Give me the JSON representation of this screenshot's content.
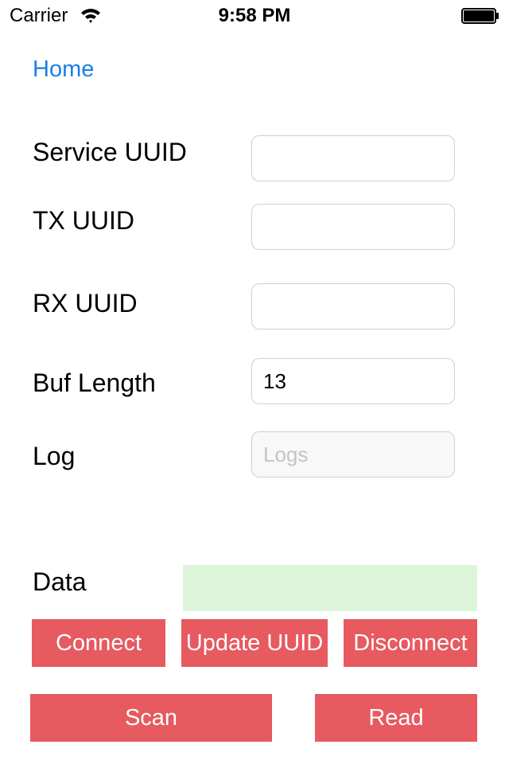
{
  "status_bar": {
    "carrier": "Carrier",
    "time": "9:58 PM",
    "wifi_icon": "wifi-icon",
    "battery_icon": "battery-icon"
  },
  "nav": {
    "home_label": "Home"
  },
  "form": {
    "service_uuid": {
      "label": "Service UUID",
      "value": ""
    },
    "tx_uuid": {
      "label": "TX UUID",
      "value": ""
    },
    "rx_uuid": {
      "label": "RX UUID",
      "value": ""
    },
    "buf_length": {
      "label": "Buf Length",
      "value": "13"
    },
    "log": {
      "label": "Log",
      "value": "",
      "placeholder": "Logs"
    },
    "data": {
      "label": "Data",
      "value": ""
    }
  },
  "buttons": {
    "connect": "Connect",
    "update_uuid": "Update UUID",
    "disconnect": "Disconnect",
    "scan": "Scan",
    "read": "Read"
  },
  "colors": {
    "link": "#1a7ee6",
    "button_bg": "#e65a60",
    "button_text": "#ffffff",
    "data_bg": "#dcf5d9"
  }
}
